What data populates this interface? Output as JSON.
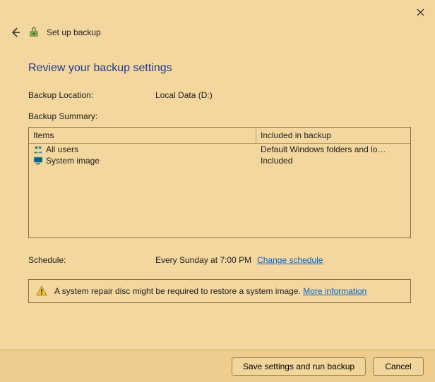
{
  "window": {
    "title": "Set up backup"
  },
  "heading": "Review your backup settings",
  "location_label": "Backup Location:",
  "location_value": "Local Data (D:)",
  "summary_label": "Backup Summary:",
  "table": {
    "head_items": "Items",
    "head_included": "Included in backup",
    "rows": [
      {
        "icon": "users-icon",
        "name": "All users",
        "included": "Default Windows folders and lo…"
      },
      {
        "icon": "monitor-icon",
        "name": "System image",
        "included": "Included"
      }
    ]
  },
  "schedule": {
    "label": "Schedule:",
    "value": "Every Sunday at 7:00 PM",
    "change_link": "Change schedule"
  },
  "warning": {
    "text": "A system repair disc might be required to restore a system image. ",
    "link": "More information"
  },
  "footer": {
    "save": "Save settings and run backup",
    "cancel": "Cancel"
  }
}
